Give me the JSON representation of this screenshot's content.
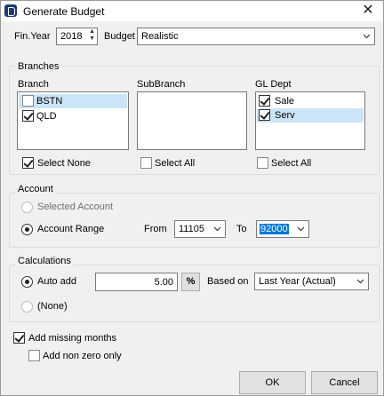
{
  "window": {
    "title": "Generate Budget",
    "close_glyph": "✕"
  },
  "fin_year": {
    "label": "Fin.Year",
    "value": "2018"
  },
  "budget": {
    "label": "Budget",
    "value": "Realistic"
  },
  "branches": {
    "title": "Branches",
    "branch": {
      "header": "Branch",
      "items": [
        {
          "label": "BSTN",
          "checked": false,
          "selected": true
        },
        {
          "label": "QLD",
          "checked": true,
          "selected": false
        }
      ],
      "toggle_label": "Select None",
      "toggle_checked": true
    },
    "subbranch": {
      "header": "SubBranch",
      "items": [],
      "toggle_label": "Select All",
      "toggle_checked": false
    },
    "gl_dept": {
      "header": "GL Dept",
      "items": [
        {
          "label": "Sale",
          "checked": true,
          "selected": false
        },
        {
          "label": "Serv",
          "checked": true,
          "selected": true
        }
      ],
      "toggle_label": "Select All",
      "toggle_checked": false
    }
  },
  "account": {
    "title": "Account",
    "selected_account_label": "Selected Account",
    "account_range_label": "Account Range",
    "mode": "range",
    "from_label": "From",
    "from_value": "11105",
    "to_label": "To",
    "to_value": "92000"
  },
  "calculations": {
    "title": "Calculations",
    "auto_add_label": "Auto add",
    "none_label": "(None)",
    "mode": "auto_add",
    "amount": "5.00",
    "percent_button": "%",
    "based_on_label": "Based on",
    "based_on_value": "Last Year (Actual)"
  },
  "options": {
    "add_missing_months_label": "Add missing months",
    "add_missing_months_checked": true,
    "add_non_zero_only_label": "Add non zero only",
    "add_non_zero_only_checked": false
  },
  "buttons": {
    "ok": "OK",
    "cancel": "Cancel"
  },
  "colors": {
    "selection_row": "#cce4f7",
    "highlight": "#0078d7",
    "app_icon": "#1d3a72"
  }
}
